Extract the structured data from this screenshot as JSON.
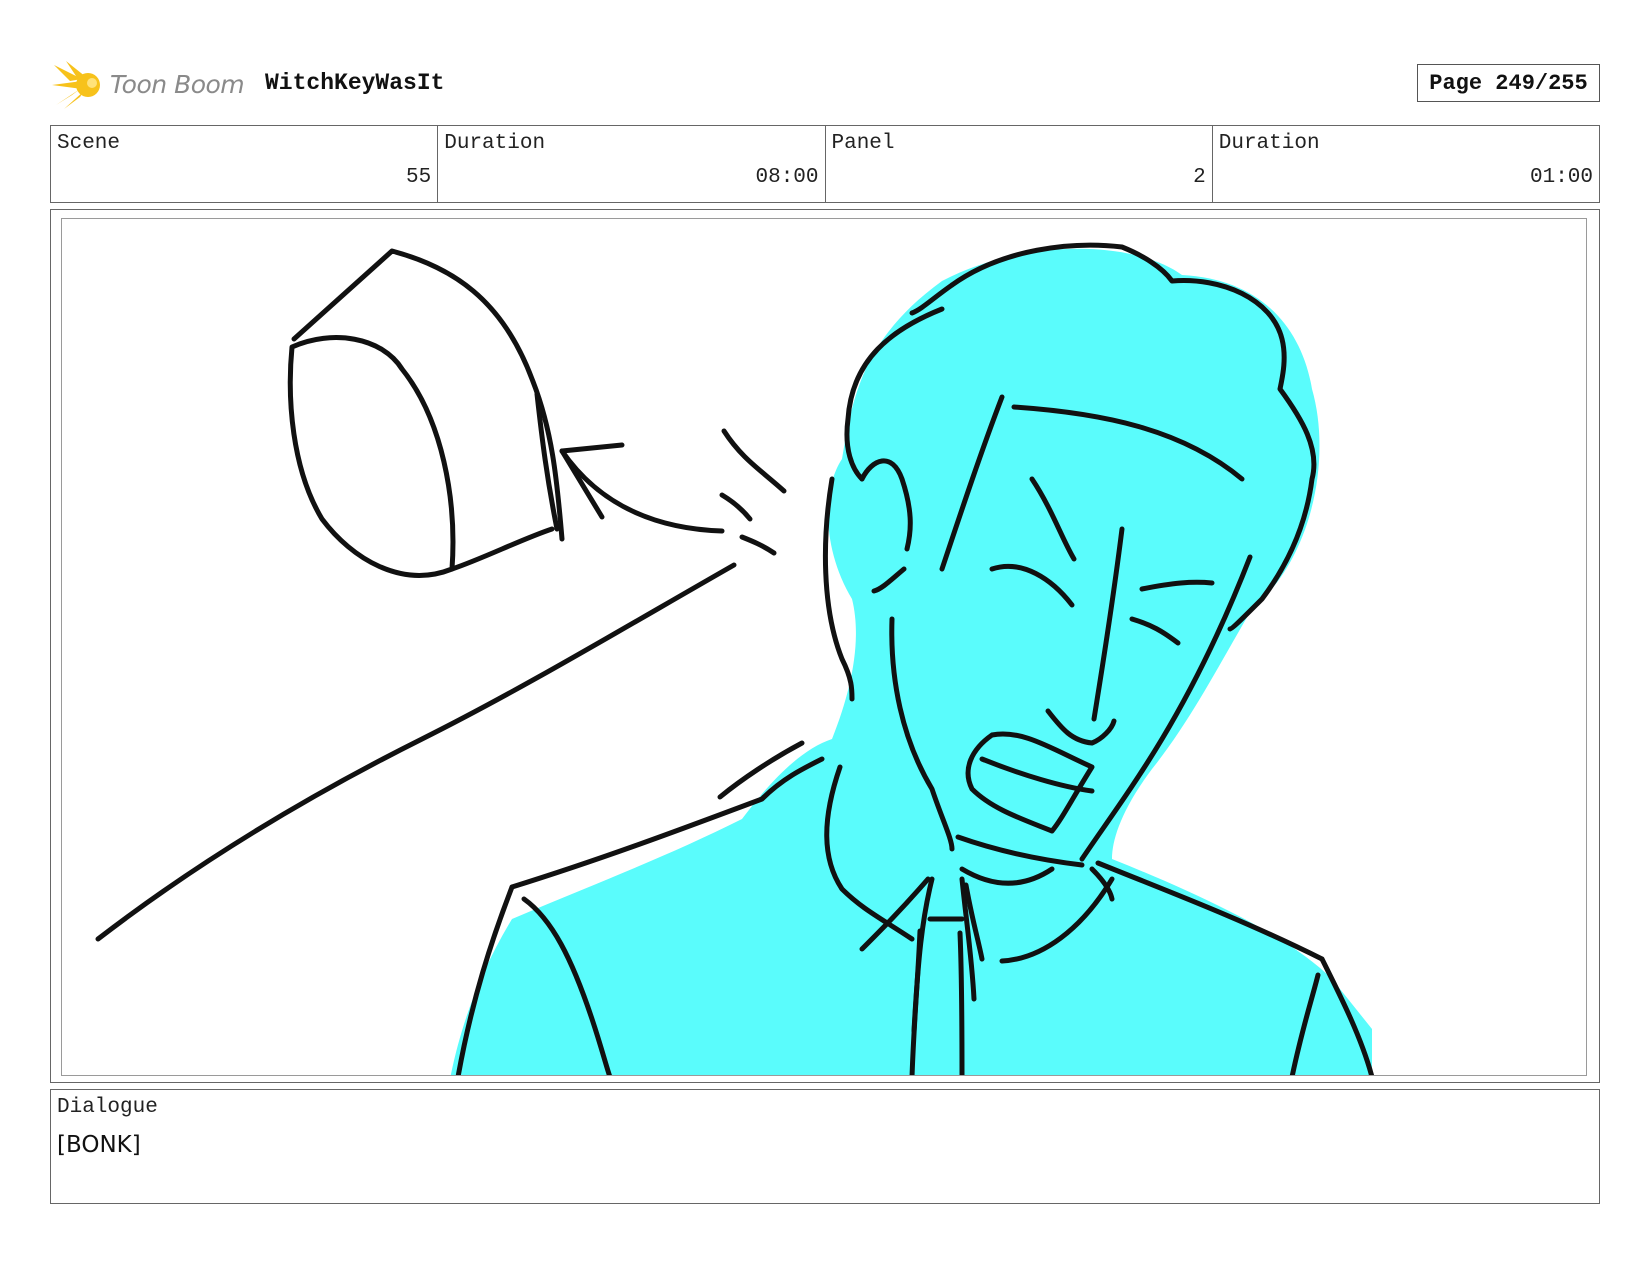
{
  "header": {
    "logo_text": "Toon Boom",
    "project_title": "WitchKeyWasIt",
    "page_label": "Page 249/255"
  },
  "info": {
    "scene_label": "Scene",
    "scene_value": "55",
    "scene_duration_label": "Duration",
    "scene_duration_value": "08:00",
    "panel_label": "Panel",
    "panel_value": "2",
    "panel_duration_label": "Duration",
    "panel_duration_value": "01:00"
  },
  "dialogue": {
    "label": "Dialogue",
    "text": "[BONK]"
  },
  "colors": {
    "character_fill": "#5afcfc",
    "line": "#111111",
    "logo_yellow": "#f7c21b"
  },
  "icons": {
    "logo": "toon-boom-star-icon"
  }
}
